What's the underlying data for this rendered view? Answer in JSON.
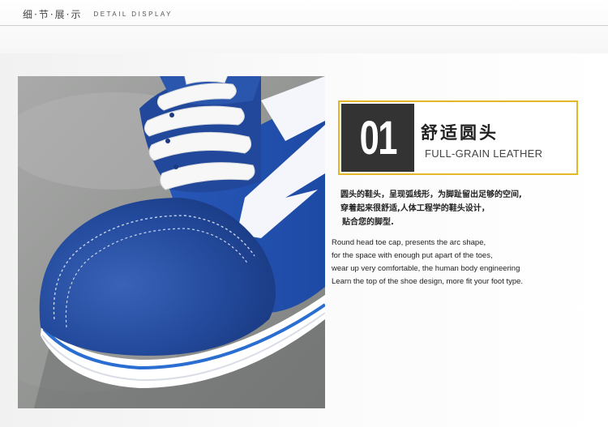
{
  "header": {
    "title_cn": "细·节·展·示",
    "title_en": "DETAIL DISPLAY"
  },
  "photo": {
    "subject": "blue suede canvas sneaker toe with white laces",
    "icon": "product-photo"
  },
  "feature": {
    "number": "01",
    "title_cn": "舒适圆头",
    "subtitle_en": "FULL-GRAIN LEATHER",
    "accent_color": "#e3b728",
    "number_bg": "#333333"
  },
  "description_cn": [
    "圆头的鞋头，呈现弧线形，为脚趾留出足够的空间,",
    "穿着起来很舒适,人体工程学的鞋头设计，",
    "贴合您的脚型."
  ],
  "description_en": [
    "Round head toe cap, presents the arc shape,",
    "for the space with enough put apart of the toes,",
    "wear up very comfortable, the human body engineering",
    "Learn the top of the shoe design, more fit your foot type."
  ]
}
